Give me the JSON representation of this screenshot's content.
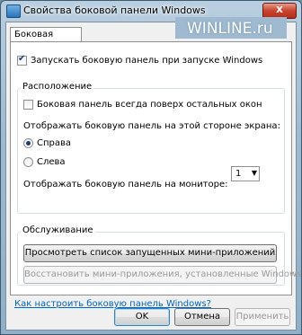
{
  "window": {
    "title": "Свойства боковой панели Windows",
    "close_label": "X"
  },
  "watermark": "WINLINE.ru",
  "tab": {
    "label": "Боковая панель"
  },
  "start_checkbox": {
    "label": "Запускать боковую панель при запуске Windows",
    "checked": true
  },
  "placement": {
    "title": "Расположение",
    "on_top": {
      "label": "Боковая панель всегда поверх остальных окон",
      "checked": false
    },
    "side_prompt": "Отображать боковую панель на этой стороне экрана:",
    "right": {
      "label": "Справа",
      "selected": true
    },
    "left": {
      "label": "Слева",
      "selected": false
    },
    "monitor_prompt": "Отображать боковую панель на мониторе:",
    "monitor_value": "1"
  },
  "maintenance": {
    "title": "Обслуживание",
    "view_button": "Просмотреть список запущенных мини-приложений",
    "restore_button": "Восстановить мини-приложения, установленные Windows"
  },
  "help_link": "Как настроить боковую панель Windows?",
  "footer": {
    "ok": "OK",
    "cancel": "Отмена",
    "apply": "Применить"
  }
}
